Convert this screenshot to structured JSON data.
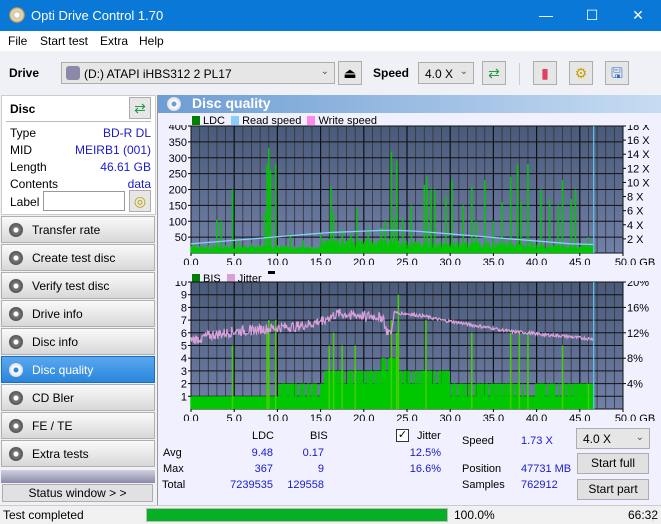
{
  "window": {
    "title": "Opti Drive Control 1.70",
    "minimize_icon": "minimize-icon",
    "maximize_icon": "maximize-icon",
    "close_icon": "close-icon"
  },
  "menu": [
    "File",
    "Start test",
    "Extra",
    "Help"
  ],
  "toolbar": {
    "drive_label": "Drive",
    "drive_value": "(D:)  ATAPI iHBS312  2 PL17",
    "speed_label": "Speed",
    "speed_value": "4.0 X"
  },
  "disc": {
    "header": "Disc",
    "rows": [
      {
        "label": "Type",
        "value": "BD-R DL"
      },
      {
        "label": "MID",
        "value": "MEIRB1 (001)"
      },
      {
        "label": "Length",
        "value": "46.61 GB"
      },
      {
        "label": "Contents",
        "value": "data"
      }
    ],
    "label_field_label": "Label",
    "label_field_value": ""
  },
  "nav": [
    {
      "label": "Transfer rate",
      "active": false
    },
    {
      "label": "Create test disc",
      "active": false
    },
    {
      "label": "Verify test disc",
      "active": false
    },
    {
      "label": "Drive info",
      "active": false
    },
    {
      "label": "Disc info",
      "active": false
    },
    {
      "label": "Disc quality",
      "active": true
    },
    {
      "label": "CD Bler",
      "active": false
    },
    {
      "label": "FE / TE",
      "active": false
    },
    {
      "label": "Extra tests",
      "active": false
    }
  ],
  "status_window_label": "Status window > >",
  "panel_title": "Disc quality",
  "colors": {
    "ldc": "#00c800",
    "read_speed": "#87cefa",
    "write_speed": "#ff88ee",
    "bis": "#00c800",
    "jitter": "#d8a0d8",
    "plot_bg": "#5a6a8a",
    "accent": "#0a78d7"
  },
  "chart_data": [
    {
      "type": "bar",
      "title": "LDC",
      "legend": [
        "LDC",
        "Read speed",
        "Write speed"
      ],
      "legend_placement": "top-left",
      "x_ticks": [
        "0.0",
        "5.0",
        "10.0",
        "15.0",
        "20.0",
        "25.0",
        "30.0",
        "35.0",
        "40.0",
        "45.0",
        "50.0 GB"
      ],
      "xlim": [
        0,
        50
      ],
      "y_ticks_left": [
        "50",
        "100",
        "150",
        "200",
        "250",
        "300",
        "350",
        "400"
      ],
      "ylim_left": [
        0,
        400
      ],
      "y_ticks_right": [
        "2 X",
        "4 X",
        "6 X",
        "8 X",
        "10 X",
        "12 X",
        "14 X",
        "16 X",
        "18 X"
      ],
      "ylim_right": [
        0,
        18
      ],
      "grid": true,
      "end_marker_gb": 46.61,
      "ldc_peaks": [
        [
          0.5,
          30
        ],
        [
          2.0,
          25
        ],
        [
          3.0,
          105
        ],
        [
          3.5,
          100
        ],
        [
          4.8,
          200
        ],
        [
          5.5,
          40
        ],
        [
          7.0,
          30
        ],
        [
          8.5,
          130
        ],
        [
          8.8,
          280
        ],
        [
          9.0,
          330
        ],
        [
          9.2,
          260
        ],
        [
          9.8,
          280
        ],
        [
          11.5,
          60
        ],
        [
          13.0,
          40
        ],
        [
          15.0,
          60
        ],
        [
          16.2,
          210
        ],
        [
          16.5,
          130
        ],
        [
          17.5,
          75
        ],
        [
          18.5,
          60
        ],
        [
          19.2,
          140
        ],
        [
          20.5,
          80
        ],
        [
          22.0,
          80
        ],
        [
          22.5,
          100
        ],
        [
          23.2,
          320
        ],
        [
          23.5,
          110
        ],
        [
          23.8,
          290
        ],
        [
          24.5,
          110
        ],
        [
          25.5,
          150
        ],
        [
          27.0,
          215
        ],
        [
          27.3,
          240
        ],
        [
          27.8,
          200
        ],
        [
          28.2,
          200
        ],
        [
          29.5,
          180
        ],
        [
          30.2,
          230
        ],
        [
          31.5,
          150
        ],
        [
          32.5,
          210
        ],
        [
          33.0,
          100
        ],
        [
          34.0,
          230
        ],
        [
          35.0,
          100
        ],
        [
          36.0,
          160
        ],
        [
          37.0,
          240
        ],
        [
          37.8,
          280
        ],
        [
          38.2,
          160
        ],
        [
          39.0,
          280
        ],
        [
          40.5,
          200
        ],
        [
          41.5,
          170
        ],
        [
          42.5,
          150
        ],
        [
          43.0,
          230
        ],
        [
          44.0,
          170
        ],
        [
          44.5,
          200
        ],
        [
          46.0,
          50
        ]
      ],
      "read_speed_steps": [
        [
          0,
          1.3
        ],
        [
          1,
          1.4
        ],
        [
          2,
          1.5
        ],
        [
          4,
          1.7
        ],
        [
          6,
          1.9
        ],
        [
          8,
          2.1
        ],
        [
          10,
          2.3
        ],
        [
          12,
          2.5
        ],
        [
          14,
          2.7
        ],
        [
          16,
          2.9
        ],
        [
          18,
          3.0
        ],
        [
          20,
          3.1
        ],
        [
          22,
          3.2
        ],
        [
          24,
          3.2
        ],
        [
          26,
          3.1
        ],
        [
          28,
          2.9
        ],
        [
          30,
          2.7
        ],
        [
          32,
          2.5
        ],
        [
          34,
          2.3
        ],
        [
          36,
          2.1
        ],
        [
          38,
          1.9
        ],
        [
          40,
          1.7
        ],
        [
          42,
          1.5
        ],
        [
          44,
          1.3
        ],
        [
          46.61,
          1.2
        ]
      ]
    },
    {
      "type": "bar",
      "title": "BIS",
      "legend": [
        "BIS",
        "Jitter"
      ],
      "legend_placement": "top-left",
      "x_ticks": [
        "0.0",
        "5.0",
        "10.0",
        "15.0",
        "20.0",
        "25.0",
        "30.0",
        "35.0",
        "40.0",
        "45.0",
        "50.0 GB"
      ],
      "xlim": [
        0,
        50
      ],
      "y_ticks_left": [
        "1",
        "2",
        "3",
        "4",
        "5",
        "6",
        "7",
        "8",
        "9",
        "10"
      ],
      "ylim_left": [
        0,
        10
      ],
      "y_ticks_right": [
        "4%",
        "8%",
        "12%",
        "16%",
        "20%"
      ],
      "ylim_right": [
        0,
        20
      ],
      "grid": true,
      "end_marker_gb": 46.61,
      "bis_base": [
        [
          0,
          1
        ],
        [
          5,
          1
        ],
        [
          10,
          2
        ],
        [
          15,
          3
        ],
        [
          22,
          4
        ],
        [
          24,
          3
        ],
        [
          30,
          2
        ],
        [
          40,
          2
        ],
        [
          46.6,
          2
        ]
      ],
      "bis_peaks": [
        [
          4.8,
          5
        ],
        [
          8.8,
          6
        ],
        [
          9.0,
          7
        ],
        [
          9.8,
          7
        ],
        [
          16.0,
          5
        ],
        [
          16.5,
          6
        ],
        [
          17.5,
          5
        ],
        [
          19.0,
          5
        ],
        [
          23.2,
          7
        ],
        [
          23.8,
          6
        ],
        [
          24.0,
          9
        ],
        [
          27.2,
          7
        ],
        [
          32.5,
          6
        ],
        [
          37.0,
          6
        ],
        [
          38.0,
          6
        ],
        [
          39.0,
          6
        ],
        [
          43.0,
          5
        ],
        [
          46.0,
          2
        ]
      ],
      "jitter_percent": [
        [
          0,
          10.8
        ],
        [
          2,
          11.5
        ],
        [
          5,
          12.2
        ],
        [
          8,
          12.5
        ],
        [
          10,
          12.8
        ],
        [
          12,
          13.0
        ],
        [
          14,
          13.4
        ],
        [
          15.5,
          14.2
        ],
        [
          17,
          15.0
        ],
        [
          19,
          14.8
        ],
        [
          21,
          14.6
        ],
        [
          22.3,
          14.5
        ],
        [
          22.5,
          12.4
        ],
        [
          23.2,
          12.0
        ],
        [
          23.5,
          15.2
        ],
        [
          25,
          15.0
        ],
        [
          27,
          14.6
        ],
        [
          29,
          14.0
        ],
        [
          31,
          13.6
        ],
        [
          33,
          13.1
        ],
        [
          35,
          12.7
        ],
        [
          37,
          12.2
        ],
        [
          39,
          12.0
        ],
        [
          41,
          11.7
        ],
        [
          43,
          11.5
        ],
        [
          45,
          11.2
        ],
        [
          46.61,
          11.0
        ]
      ]
    }
  ],
  "stats": {
    "col_ldc": "LDC",
    "col_bis": "BIS",
    "jitter_label": "Jitter",
    "jitter_checked": true,
    "rows": [
      {
        "label": "Avg",
        "ldc": "9.48",
        "bis": "0.17",
        "jitter": "12.5%"
      },
      {
        "label": "Max",
        "ldc": "367",
        "bis": "9",
        "jitter": "16.6%"
      },
      {
        "label": "Total",
        "ldc": "7239535",
        "bis": "129558",
        "jitter": ""
      }
    ],
    "speed_label": "Speed",
    "speed_value": "1.73 X",
    "position_label": "Position",
    "position_value": "47731 MB",
    "samples_label": "Samples",
    "samples_value": "762912",
    "speed_select": "4.0 X",
    "start_full": "Start full",
    "start_part": "Start part"
  },
  "statusbar": {
    "text": "Test completed",
    "progress_percent": 100.0,
    "progress_label": "100.0%",
    "time": "66:32"
  }
}
